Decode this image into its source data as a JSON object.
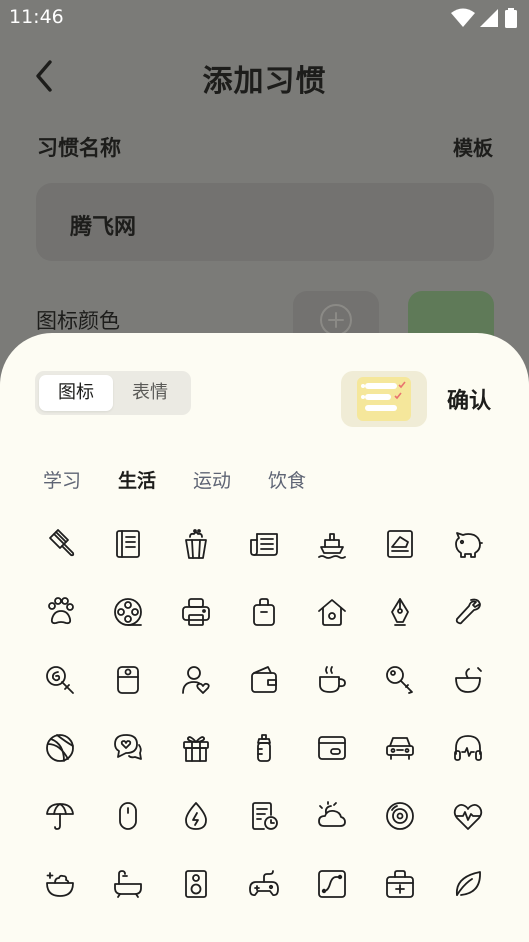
{
  "status_bar": {
    "time": "11:46"
  },
  "header": {
    "title": "添加习惯"
  },
  "form": {
    "name_label": "习惯名称",
    "template_label": "模板",
    "name_value": "腾飞网",
    "icon_color_label": "图标颜色",
    "selected_color": "#5f7a58"
  },
  "sheet": {
    "segments": [
      {
        "label": "图标",
        "active": true
      },
      {
        "label": "表情",
        "active": false
      }
    ],
    "confirm_label": "确认",
    "categories": [
      {
        "label": "学习",
        "active": false
      },
      {
        "label": "生活",
        "active": true
      },
      {
        "label": "运动",
        "active": false
      },
      {
        "label": "饮食",
        "active": false
      }
    ],
    "icons": [
      "popsicle-icon",
      "notebook-icon",
      "popcorn-icon",
      "newspaper-icon",
      "ship-icon",
      "photo-frame-icon",
      "piggy-bank-icon",
      "paw-icon",
      "film-reel-icon",
      "printer-icon",
      "bag-icon",
      "home-icon",
      "fountain-pen-icon",
      "wrench-icon",
      "lollipop-icon",
      "rice-cooker-icon",
      "user-heart-icon",
      "wallet-icon",
      "coffee-cup-icon",
      "key-icon",
      "bowl-icon",
      "ball-icon",
      "chat-heart-icon",
      "gift-icon",
      "baby-bottle-icon",
      "card-icon",
      "car-icon",
      "headphones-icon",
      "umbrella-icon",
      "mouse-icon",
      "water-drop-icon",
      "document-clock-icon",
      "sun-cloud-icon",
      "disc-icon",
      "heartbeat-icon",
      "salad-bowl-icon",
      "bathtub-icon",
      "speaker-icon",
      "game-controller-icon",
      "graph-card-icon",
      "medical-kit-icon",
      "leaf-icon"
    ]
  }
}
